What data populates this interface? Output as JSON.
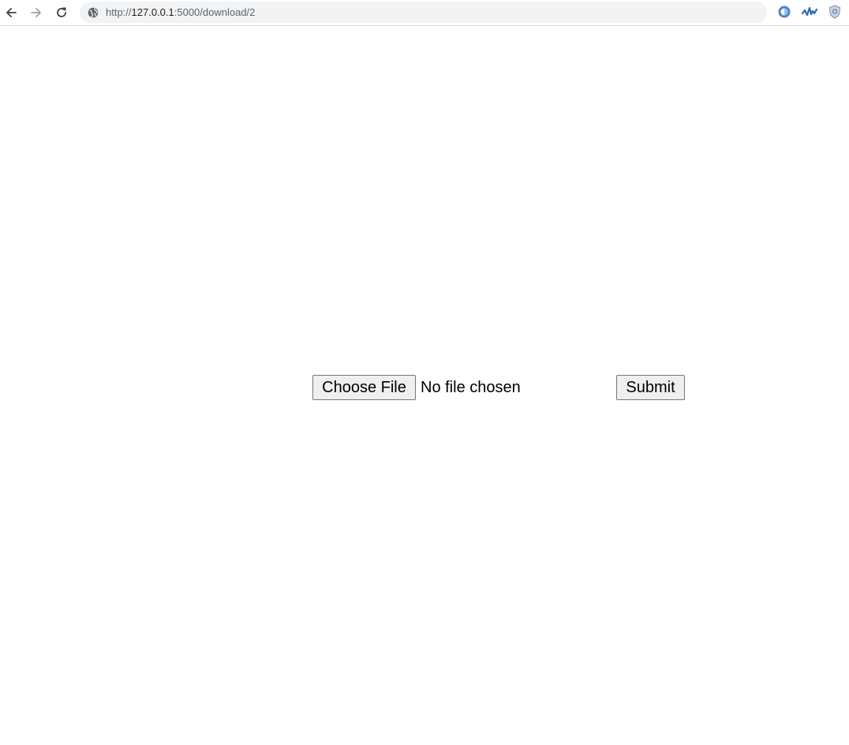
{
  "browser": {
    "url_scheme": "http://",
    "url_host": "127.0.0.1",
    "url_path": ":5000/download/2",
    "icons": {
      "back": "arrow-left-icon",
      "forward": "arrow-right-icon",
      "reload": "reload-icon",
      "site_info": "globe-icon"
    },
    "extensions": [
      "blue-circle-extension-icon",
      "waveform-extension-icon",
      "shield-extension-icon"
    ]
  },
  "form": {
    "choose_file_label": "Choose File",
    "file_status": "No file chosen",
    "submit_label": "Submit"
  },
  "colors": {
    "toolbar_bg": "#ffffff",
    "omnibox_bg": "#f1f3f4",
    "button_bg": "#efefef",
    "button_border": "#767676"
  }
}
